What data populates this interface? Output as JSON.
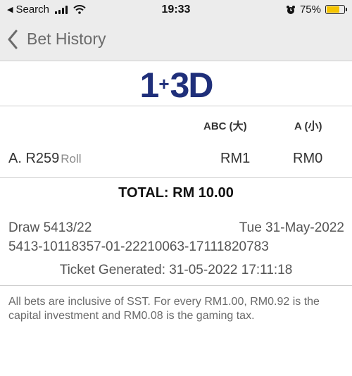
{
  "status_bar": {
    "back_label": "Search",
    "time": "19:33",
    "battery_percent_label": "75%",
    "battery_level": 0.75
  },
  "nav": {
    "back_title": "Bet History"
  },
  "logo": {
    "left": "1",
    "plus": "+",
    "right": "3D"
  },
  "bet_table": {
    "column_headers": [
      "ABC (大)",
      "A (小)"
    ],
    "rows": [
      {
        "label": "A.",
        "number": "R259",
        "type": "Roll",
        "abc": "RM1",
        "a": "RM0"
      }
    ]
  },
  "total_label": "TOTAL: RM 10.00",
  "draw": {
    "draw_no": "Draw 5413/22",
    "draw_date": "Tue 31-May-2022",
    "ticket_id": "5413-10118357-01-22210063-17111820783",
    "ticket_generated": "Ticket Generated: 31-05-2022 17:11:18"
  },
  "disclaimer": "All bets are inclusive of SST. For every RM1.00, RM0.92 is the capital investment and RM0.08 is the gaming tax.",
  "colors": {
    "brand": "#1f2f7a",
    "battery_fill": "#f5c400",
    "bar_background": "#ececec"
  }
}
